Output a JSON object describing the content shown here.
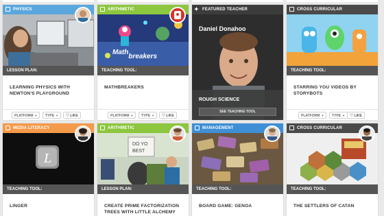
{
  "colors": {
    "physics": "#5aa7de",
    "arithmetic": "#8dc63f",
    "featured": "#3c3c3c",
    "cross_curricular": "#4a4a4a",
    "media_literacy": "#f59a4a",
    "management": "#3f8fd6"
  },
  "row1": [
    {
      "category": "PHYSICS",
      "type": "LESSON PLAN:",
      "title": "LEARNING PHYSICS WITH NEWTON'S PLAYGROUND",
      "platform": "PLATFORM",
      "type_filter": "TYPE",
      "like": "LIKE"
    },
    {
      "category": "ARITHMETIC",
      "type": "TEACHING TOOL:",
      "title": "MATHBREAKERS",
      "image_text_a": "Math",
      "image_text_b": "breakers",
      "platform": "PLATFORM",
      "type_filter": "TYPE",
      "like": "LIKE"
    },
    {
      "category": "FEATURED TEACHER",
      "name": "Daniel Donahoo",
      "subtitle": "ROUGH SCIENCE",
      "button": "SEE TEACHING TOOL"
    },
    {
      "category": "CROSS CURRICULAR",
      "type": "TEACHING TOOL:",
      "title": "STARRING YOU VIDEOS BY STORYBOTS",
      "platform": "PLATFORM",
      "type_filter": "TYPE",
      "like": "LIKE"
    }
  ],
  "row2": [
    {
      "category": "MEDIA LITERACY",
      "type": "TEACHING TOOL:",
      "title": "LINGER"
    },
    {
      "category": "ARITHMETIC",
      "type": "LESSON PLAN:",
      "title": "CREATE PRIME FACTORIZATION TREES WITH LITTLE ALCHEMY"
    },
    {
      "category": "MANAGEMENT",
      "type": "TEACHING TOOL:",
      "title": "BOARD GAME: GENOA"
    },
    {
      "category": "CROSS CURRICULAR",
      "type": "TEACHING TOOL:",
      "title": "THE SETTLERS OF CATAN"
    }
  ]
}
